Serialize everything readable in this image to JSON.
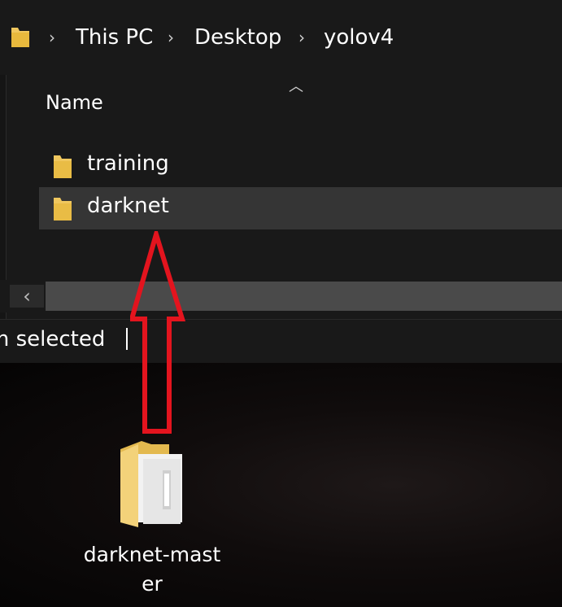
{
  "addressbar": {
    "breadcrumbs": [
      "This PC",
      "Desktop",
      "yolov4"
    ]
  },
  "filelist": {
    "column_name": "Name",
    "rows": [
      {
        "label": "training",
        "selected": false
      },
      {
        "label": "darknet",
        "selected": true
      }
    ]
  },
  "statusbar": {
    "text": "m selected"
  },
  "desktop": {
    "icon_label_line1": "darknet-mast",
    "icon_label_line2": "er"
  },
  "colors": {
    "explorer_bg": "#191919",
    "selection": "#353535",
    "folder_yellow": "#f0c75e",
    "annotation_arrow": "#e3141e"
  }
}
